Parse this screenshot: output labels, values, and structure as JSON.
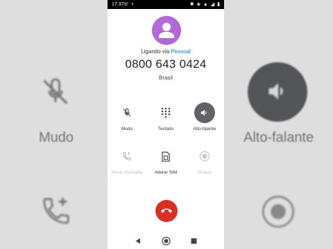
{
  "status_bar": {
    "time": "17:37",
    "left_icons": "☏ •",
    "right_icons": "✱ ◈ ▲ ◢ ▮"
  },
  "call": {
    "calling_prefix": "Ligando via",
    "calling_account": "Pessoal",
    "number": "0800 643 0424",
    "country": "Brasil"
  },
  "controls": [
    {
      "label": "Mudo",
      "icon": "mic-off-icon",
      "state": "enabled"
    },
    {
      "label": "Teclado",
      "icon": "dialpad-icon",
      "state": "enabled"
    },
    {
      "label": "Alto-falante",
      "icon": "speaker-icon",
      "state": "active"
    },
    {
      "label": "Nova chamada",
      "icon": "add-call-icon",
      "state": "disabled"
    },
    {
      "label": "Alterar SIM",
      "icon": "sim-card-icon",
      "state": "enabled"
    },
    {
      "label": "Gravar",
      "icon": "record-icon",
      "state": "disabled"
    }
  ],
  "background_zoom": {
    "left_label": "Mudo",
    "right_label": "Alto-falante"
  },
  "colors": {
    "avatar": "#b36ad6",
    "accent_link": "#1a73e8",
    "end_call": "#d93025",
    "active_control": "#5f6368"
  }
}
